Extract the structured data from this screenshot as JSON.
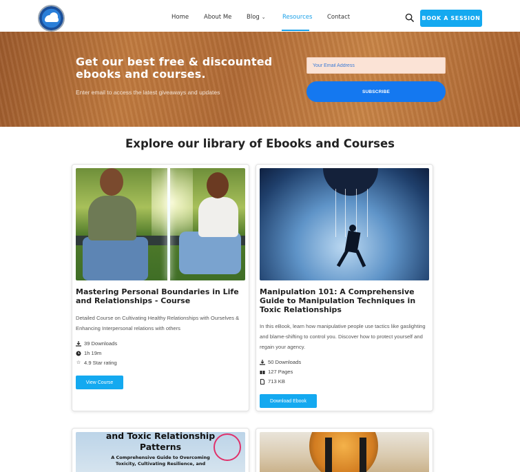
{
  "header": {
    "logo_alt": "logo",
    "nav": [
      "Home",
      "About Me",
      "Blog",
      "Resources",
      "Contact"
    ],
    "active_nav": "Resources",
    "book_button": "BOOK A SESSION"
  },
  "banner": {
    "title": "Get our best free & discounted ebooks and courses.",
    "subtitle": "Enter email to access the latest giveaways and updates",
    "email_placeholder": "Your Email Address",
    "subscribe_label": "SUBSCRIBE"
  },
  "section": {
    "title": "Explore our library of Ebooks and Courses"
  },
  "cards": [
    {
      "title": "Mastering Personal Boundaries in Life and Relationships - Course",
      "description": "Detailed Course on Cultivating Healthy Relationships with Ourselves & Enhancing Interpersonal relations with others",
      "meta": [
        "39 Downloads",
        "1h 19m",
        "4.9 Star rating"
      ],
      "button": "View Course"
    },
    {
      "title": "Manipulation 101: A Comprehensive Guide to Manipulation Techniques in Toxic Relationships",
      "description": "In this eBook, learn how manipulative people use tactics like gaslighting and blame-shifting to control you. Discover how to protect yourself and regain your agency.",
      "meta": [
        "50 Downloads",
        "127 Pages",
        "713 KB"
      ],
      "button": "Download Ebook"
    }
  ],
  "partial_cards": [
    {
      "cover_line1": "and Toxic Relationship",
      "cover_line2": "Patterns",
      "cover_line3": "A Comprehensive Guide to Overcoming",
      "cover_line4": "Toxicity, Cultivating Resilience, and"
    }
  ],
  "colors": {
    "accent": "#14a9f0",
    "subscribe": "#1478f0",
    "active_nav": "#1aa0e8"
  }
}
